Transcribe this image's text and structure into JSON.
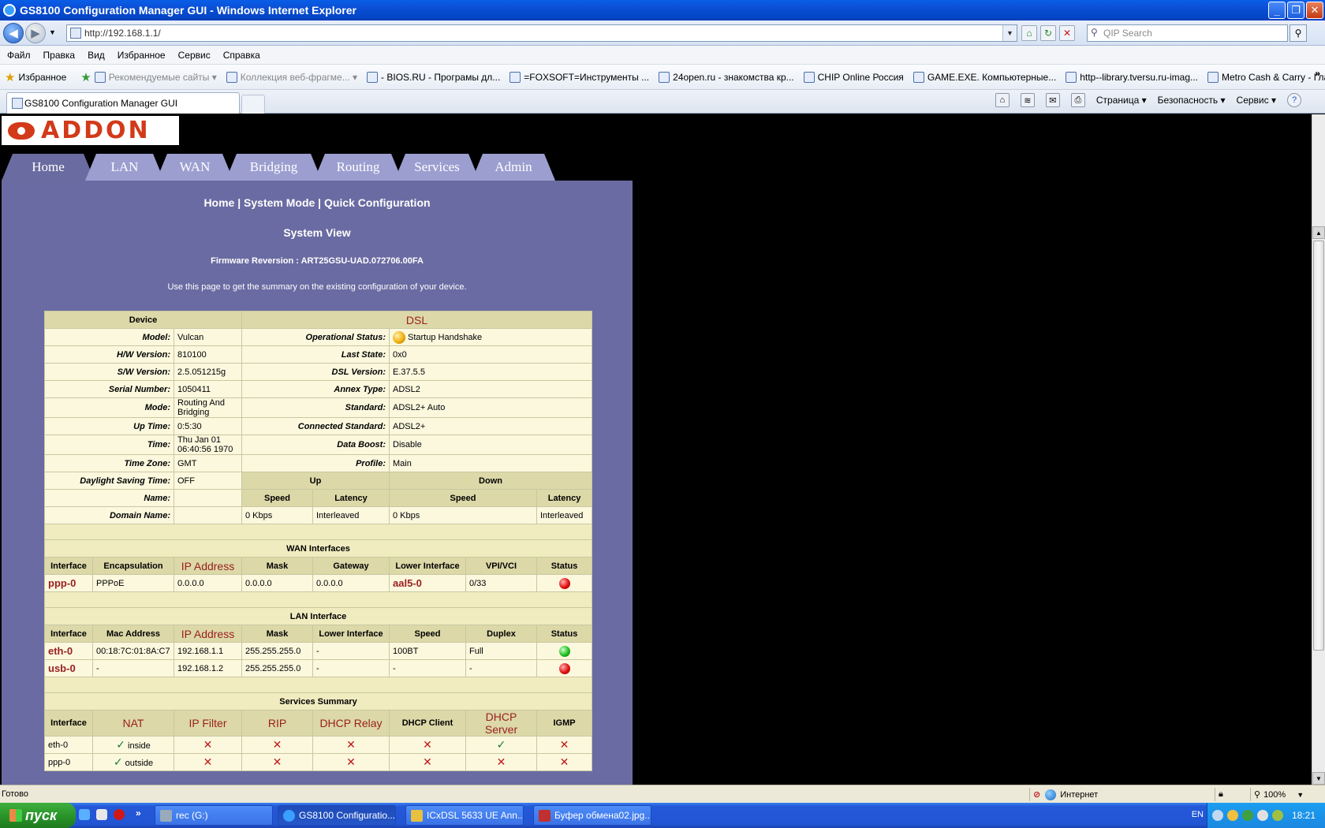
{
  "window": {
    "title": "GS8100 Configuration Manager GUI - Windows Internet Explorer",
    "minimize": "_",
    "maximize": "❐",
    "close": "✕"
  },
  "address": {
    "url": "http://192.168.1.1/",
    "search_placeholder": "QIP Search"
  },
  "menu": [
    "Файл",
    "Правка",
    "Вид",
    "Избранное",
    "Сервис",
    "Справка"
  ],
  "favorites": {
    "label": "Избранное",
    "items": [
      {
        "label": "Рекомендуемые сайты ▾",
        "gray": true
      },
      {
        "label": "Коллекция веб-фрагме... ▾",
        "gray": true
      },
      {
        "label": "- BIOS.RU - Програмы дл...",
        "gray": false
      },
      {
        "label": "=FOXSOFT=Инструменты ...",
        "gray": false
      },
      {
        "label": "24open.ru - знакомства кр...",
        "gray": false
      },
      {
        "label": "CHIP Online Россия",
        "gray": false
      },
      {
        "label": "GAME.EXE. Компьютерные...",
        "gray": false
      },
      {
        "label": "http--library.tversu.ru-imag...",
        "gray": false
      },
      {
        "label": "Metro Cash & Carry - Главная",
        "gray": false
      }
    ],
    "more": "»"
  },
  "tabs": {
    "current": "GS8100 Configuration Manager GUI"
  },
  "command_bar": {
    "page": "Страница ▾",
    "safety": "Безопасность ▾",
    "tools": "Сервис ▾"
  },
  "router": {
    "logo": "ADDON",
    "nav": [
      "Home",
      "LAN",
      "WAN",
      "Bridging",
      "Routing",
      "Services",
      "Admin"
    ],
    "crumbs": {
      "home": "Home",
      "sep1": " | ",
      "system_mode": "System Mode",
      "sep2": " | ",
      "quick_config": "Quick Configuration"
    },
    "heading": "System View",
    "firmware": "Firmware Reversion : ART25GSU-UAD.072706.00FA",
    "description": "Use this page to get the summary on the existing configuration of your device.",
    "device_header": "Device",
    "dsl_header": "DSL",
    "device": [
      {
        "label": "Model:",
        "value": "Vulcan"
      },
      {
        "label": "H/W Version:",
        "value": "810100"
      },
      {
        "label": "S/W Version:",
        "value": "2.5.051215g"
      },
      {
        "label": "Serial Number:",
        "value": "1050411"
      },
      {
        "label": "Mode:",
        "value": "Routing And Bridging"
      },
      {
        "label": "Up Time:",
        "value": "0:5:30"
      },
      {
        "label": "Time:",
        "value": "Thu Jan 01 06:40:56 1970"
      },
      {
        "label": "Time Zone:",
        "value": "GMT"
      },
      {
        "label": "Daylight Saving Time:",
        "value": "OFF"
      },
      {
        "label": "Name:",
        "value": ""
      },
      {
        "label": "Domain Name:",
        "value": ""
      }
    ],
    "dsl": [
      {
        "label": "Operational Status:",
        "value": "Startup Handshake"
      },
      {
        "label": "Last State:",
        "value": "0x0"
      },
      {
        "label": "DSL Version:",
        "value": "E.37.5.5"
      },
      {
        "label": "Annex Type:",
        "value": "ADSL2"
      },
      {
        "label": "Standard:",
        "value": "ADSL2+ Auto"
      },
      {
        "label": "Connected Standard:",
        "value": "ADSL2+"
      },
      {
        "label": "Data Boost:",
        "value": "Disable"
      },
      {
        "label": "Profile:",
        "value": "Main"
      }
    ],
    "dsl_rates": {
      "up": "Up",
      "down": "Down",
      "speed": "Speed",
      "latency": "Latency",
      "up_speed": "0 Kbps",
      "up_latency": "Interleaved",
      "down_speed": "0 Kbps",
      "down_latency": "Interleaved"
    },
    "wan": {
      "title": "WAN Interfaces",
      "headers": [
        "Interface",
        "Encapsulation",
        "IP Address",
        "Mask",
        "Gateway",
        "Lower Interface",
        "VPI/VCI",
        "Status"
      ],
      "rows": [
        {
          "interface": "ppp-0",
          "encap": "PPPoE",
          "ip": "0.0.0.0",
          "mask": "0.0.0.0",
          "gateway": "0.0.0.0",
          "lower": "aal5-0",
          "vpivci": "0/33",
          "status": "red"
        }
      ]
    },
    "lan": {
      "title": "LAN Interface",
      "headers": [
        "Interface",
        "Mac Address",
        "IP Address",
        "Mask",
        "Lower Interface",
        "Speed",
        "Duplex",
        "Status"
      ],
      "rows": [
        {
          "interface": "eth-0",
          "mac": "00:18:7C:01:8A:C7",
          "ip": "192.168.1.1",
          "mask": "255.255.255.0",
          "lower": "-",
          "speed": "100BT",
          "duplex": "Full",
          "status": "green"
        },
        {
          "interface": "usb-0",
          "mac": "-",
          "ip": "192.168.1.2",
          "mask": "255.255.255.0",
          "lower": "-",
          "speed": "-",
          "duplex": "-",
          "status": "red"
        }
      ]
    },
    "services": {
      "title": "Services Summary",
      "headers": [
        "Interface",
        "NAT",
        "IP Filter",
        "RIP",
        "DHCP Relay",
        "DHCP Client",
        "DHCP Server",
        "IGMP"
      ],
      "rows": [
        {
          "interface": "eth-0",
          "nat": "✓",
          "nat_text": "inside",
          "ipfilter": "✕",
          "rip": "✕",
          "dhcp_relay": "✕",
          "dhcp_client": "✕",
          "dhcp_server": "✓",
          "igmp": "✕"
        },
        {
          "interface": "ppp-0",
          "nat": "✓",
          "nat_text": "outside",
          "ipfilter": "✕",
          "rip": "✕",
          "dhcp_relay": "✕",
          "dhcp_client": "✕",
          "dhcp_server": "✕",
          "igmp": "✕"
        }
      ]
    }
  },
  "statusbar": {
    "text": "Готово",
    "zone": "Интернет",
    "zoom": "100%"
  },
  "taskbar": {
    "start": "пуск",
    "more": "»",
    "tasks": [
      {
        "label": "rec (G:)",
        "active": false
      },
      {
        "label": "GS8100 Configuratio...",
        "active": true
      },
      {
        "label": "ICxDSL 5633 UE Ann...",
        "active": false
      },
      {
        "label": "Буфер обмена02.jpg...",
        "active": false
      }
    ],
    "lang": "EN",
    "clock": "18:21"
  }
}
